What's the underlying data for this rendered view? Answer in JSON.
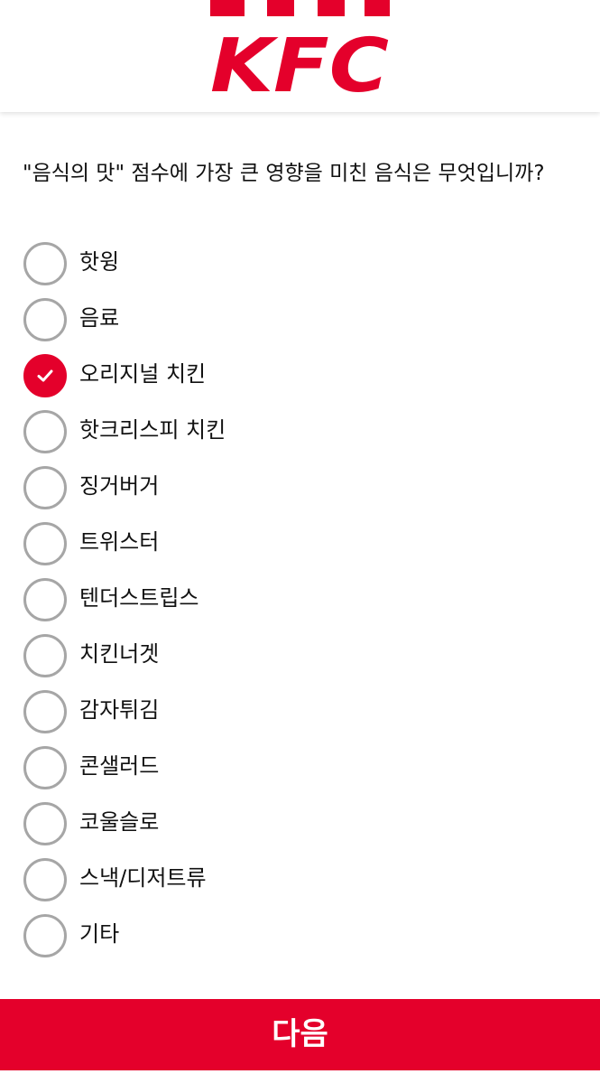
{
  "header": {
    "logo_text": "KFC",
    "brand_color": "#e4002b"
  },
  "question": {
    "text": "\"음식의 맛\" 점수에 가장 큰 영향을 미친 음식은 무엇입니까?"
  },
  "options": [
    {
      "label": "핫윙",
      "checked": false
    },
    {
      "label": "음료",
      "checked": false
    },
    {
      "label": "오리지널 치킨",
      "checked": true
    },
    {
      "label": "핫크리스피 치킨",
      "checked": false
    },
    {
      "label": "징거버거",
      "checked": false
    },
    {
      "label": "트위스터",
      "checked": false
    },
    {
      "label": "텐더스트립스",
      "checked": false
    },
    {
      "label": "치킨너겟",
      "checked": false
    },
    {
      "label": "감자튀김",
      "checked": false
    },
    {
      "label": "콘샐러드",
      "checked": false
    },
    {
      "label": "코울슬로",
      "checked": false
    },
    {
      "label": "스낵/디저트류",
      "checked": false
    },
    {
      "label": "기타",
      "checked": false
    }
  ],
  "footer": {
    "next_label": "다음"
  }
}
